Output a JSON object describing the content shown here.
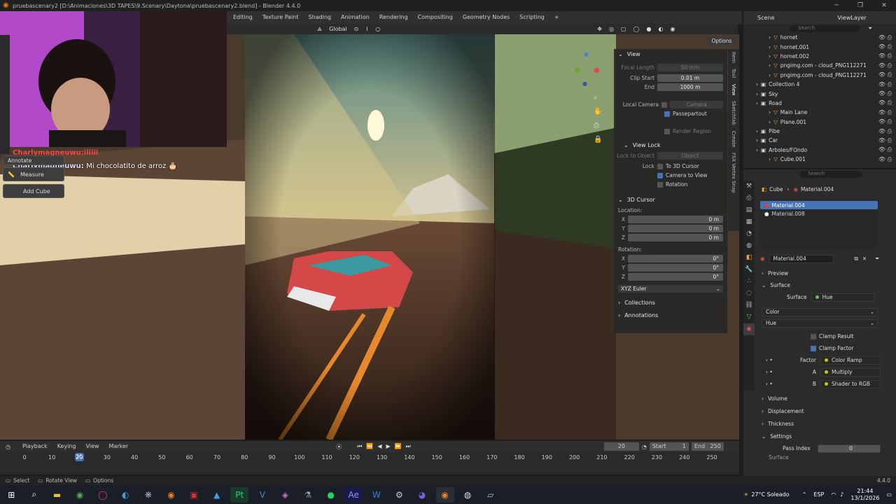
{
  "window": {
    "title": "pruebascenary2 [D:\\Animaciones\\3D TAPES\\9.Scenary\\Daytona\\pruebascenary2.blend] - Blender 4.4.0",
    "min": "─",
    "max": "❐",
    "close": "✕"
  },
  "workspaces": [
    "Editing",
    "Texture Paint",
    "Shading",
    "Animation",
    "Rendering",
    "Compositing",
    "Geometry Nodes",
    "Scripting",
    "+"
  ],
  "scene": {
    "scene_label": "Scene",
    "viewlayer_label": "ViewLayer"
  },
  "header": {
    "orientation": "Global",
    "options": "Options"
  },
  "tools": {
    "annotate": "Annotate",
    "measure": "Measure",
    "add_cube": "Add Cube"
  },
  "chat": {
    "user": "Charlymagneuwu",
    "message": "Mi chocolatito de arroz 🎂",
    "banner": "Charlymagneuwu:iiiiii"
  },
  "npanel": {
    "view_title": "View",
    "focal_length": {
      "label": "Focal Length",
      "value": "50 mm"
    },
    "clip_start": {
      "label": "Clip Start",
      "value": "0.01 m"
    },
    "end": {
      "label": "End",
      "value": "1000 m"
    },
    "local_camera": {
      "label": "Local Camera",
      "value": "Camera"
    },
    "passepartout": "Passepartout",
    "render_region": "Render Region",
    "view_lock_title": "View Lock",
    "lock_to_object": {
      "label": "Lock to Object",
      "value": "Object"
    },
    "lock_label": "Lock",
    "to_3d_cursor": "To 3D Cursor",
    "camera_to_view": "Camera to View",
    "rotation_check": "Rotation",
    "cursor_title": "3D Cursor",
    "location_label": "Location:",
    "loc": [
      {
        "axis": "X",
        "value": "0 m"
      },
      {
        "axis": "Y",
        "value": "0 m"
      },
      {
        "axis": "Z",
        "value": "0 m"
      }
    ],
    "rotation_label": "Rotation:",
    "rot": [
      {
        "axis": "X",
        "value": "0°"
      },
      {
        "axis": "Y",
        "value": "0°"
      },
      {
        "axis": "Z",
        "value": "0°"
      }
    ],
    "euler": "XYZ Euler",
    "collections": "Collections",
    "annotations": "Annotations",
    "tabs": [
      "Item",
      "Tool",
      "View",
      "Sketchfab",
      "Create",
      "FSX Vertex Snap"
    ]
  },
  "outliner": {
    "search_placeholder": "Search",
    "items": [
      {
        "name": "hornet",
        "indent": 2
      },
      {
        "name": "hornet.001",
        "indent": 2
      },
      {
        "name": "hornet.002",
        "indent": 2
      },
      {
        "name": "pngimg.com - cloud_PNG112271",
        "indent": 2
      },
      {
        "name": "pngimg.com - cloud_PNG112271",
        "indent": 2
      },
      {
        "name": "Collection 4",
        "indent": 1
      },
      {
        "name": "Sky",
        "indent": 1
      },
      {
        "name": "Road",
        "indent": 1
      },
      {
        "name": "Main Lane",
        "indent": 2
      },
      {
        "name": "Plane.001",
        "indent": 2
      },
      {
        "name": "Pibe",
        "indent": 1
      },
      {
        "name": "Car",
        "indent": 1
      },
      {
        "name": "Arboles/FOndo",
        "indent": 1
      },
      {
        "name": "Cube.001",
        "indent": 2
      }
    ]
  },
  "properties": {
    "breadcrumb_object": "Cube",
    "breadcrumb_material": "Material.004",
    "search_placeholder": "Search",
    "slots": [
      "Material.004",
      "Material.008"
    ],
    "material_name": "Material.004",
    "preview": "Preview",
    "surface_section": "Surface",
    "surface_label": "Surface",
    "surface_value": "Hue",
    "color_dd": "Color",
    "hue_dd": "Hue",
    "clamp_result": "Clamp Result",
    "clamp_factor": "Clamp Factor",
    "inputs": [
      {
        "label": "Factor",
        "value": "Color Ramp"
      },
      {
        "label": "A",
        "value": "Multiply"
      },
      {
        "label": "B",
        "value": "Shader to RGB"
      }
    ],
    "volume": "Volume",
    "displacement": "Displacement",
    "thickness": "Thickness",
    "settings": "Settings",
    "pass_index_label": "Pass Index",
    "pass_index_value": "0",
    "surface_cut": "Surface"
  },
  "timeline": {
    "menus": [
      "Playback",
      "Keying",
      "View",
      "Marker"
    ],
    "current": "20",
    "start_label": "Start",
    "start": "1",
    "end_label": "End",
    "end": "250",
    "ticks": [
      "0",
      "10",
      "20",
      "30",
      "40",
      "50",
      "60",
      "70",
      "80",
      "90",
      "100",
      "110",
      "120",
      "130",
      "140",
      "150",
      "160",
      "170",
      "180",
      "190",
      "200",
      "210",
      "220",
      "230",
      "240",
      "250"
    ]
  },
  "status": {
    "select": "Select",
    "rotate_view": "Rotate View",
    "options": "Options",
    "version": "4.4.0"
  },
  "taskbar": {
    "weather": "27°C Soleado",
    "lang": "ESP",
    "time": "21:44",
    "date": "13/1/2026"
  }
}
